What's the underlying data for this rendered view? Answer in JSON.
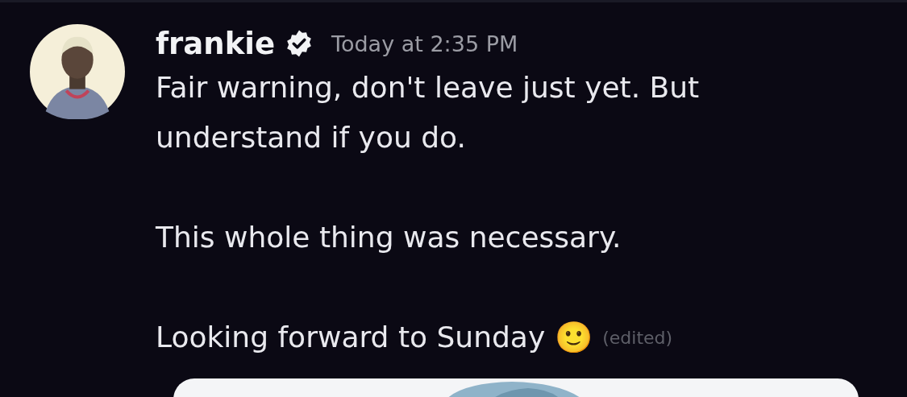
{
  "message": {
    "author": "frankie",
    "verified": true,
    "timestamp": "Today at 2:35 PM",
    "paragraphs": [
      "Fair warning, don't leave just yet. But understand if you do.",
      "This whole thing was necessary.",
      "Looking forward to Sunday"
    ],
    "trailing_emoji": "🙂",
    "edited_label": "(edited)"
  }
}
